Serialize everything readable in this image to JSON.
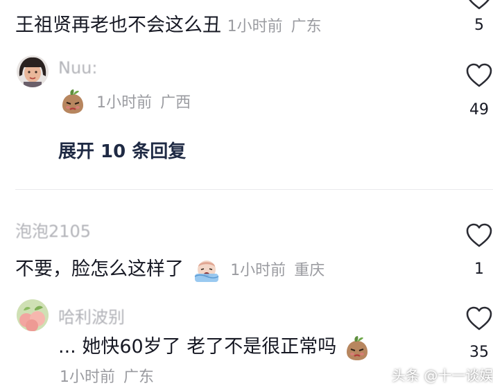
{
  "comments": [
    {
      "text": "王祖贤再老也不会这么丑",
      "time": "1小时前",
      "location": "广东",
      "likes": "5"
    },
    {
      "username": "Nuu:",
      "time": "1小时前",
      "location": "广西",
      "likes": "49",
      "expand_label": "展开 10 条回复"
    },
    {
      "username": "泡泡2105",
      "text": "不要，脸怎么这样了",
      "time": "1小时前",
      "location": "重庆",
      "likes": "1"
    },
    {
      "username": "哈利波别",
      "text": "... 她快60岁了 老了不是很正常吗",
      "time": "1小时前",
      "location": "广东",
      "likes": "35"
    }
  ],
  "watermark": "头条 @十一谈娱",
  "icons": {
    "like": "heart-outline-icon",
    "emoji_pout": "pouting-bean-emoji",
    "emoji_cry": "crying-face-emoji"
  },
  "colors": {
    "text": "#161823",
    "meta": "#9a9ba0",
    "expand": "#1f2a44",
    "icon": "#2a2b33"
  }
}
